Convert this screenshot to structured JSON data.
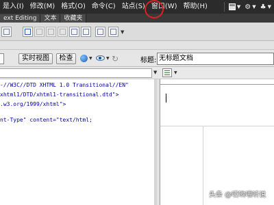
{
  "menubar": {
    "items": [
      {
        "label": "是入(I)"
      },
      {
        "label": "修改(M)"
      },
      {
        "label": "格式(O)"
      },
      {
        "label": "命令(C)"
      },
      {
        "label": "站点(S)"
      },
      {
        "label": "窗口(W)"
      },
      {
        "label": "帮助(H)"
      }
    ],
    "right_icons": [
      "layout-icon",
      "gear-icon",
      "site-icon"
    ]
  },
  "tabs": [
    {
      "label": "ext Editing"
    },
    {
      "label": "文本"
    },
    {
      "label": "收藏夹"
    }
  ],
  "doc_toolbar": {
    "live_view_label": "实时视图",
    "inspect_label": "检查",
    "title_label": "标题:",
    "title_value": "无标题文档"
  },
  "code": {
    "lines": [
      "-//W3C//DTD XHTML 1.0 Transitional//EN\"",
      "xhtml1/DTD/xhtml1-transitional.dtd\">",
      ".w3.org/1999/xhtml\">",
      "nt-Type\" content=\"text/html;"
    ]
  },
  "annotation": {
    "highlight_color": "#e02020"
  },
  "watermark": {
    "text": "头条 @哎哟喂听说"
  }
}
